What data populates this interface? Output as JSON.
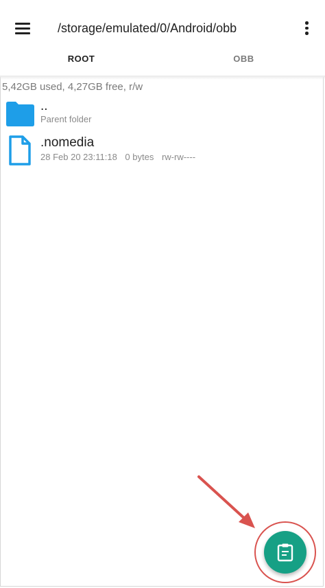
{
  "appbar": {
    "menu_icon": "hamburger-menu-icon",
    "path": "/storage/emulated/0/Android/obb",
    "overflow_icon": "more-vert-icon"
  },
  "tabs": [
    {
      "label": "ROOT",
      "active": true
    },
    {
      "label": "OBB",
      "active": false
    }
  ],
  "storage_info": "5,42GB used, 4,27GB free, r/w",
  "files": [
    {
      "icon": "folder-icon",
      "name": "..",
      "subtitle": "Parent folder"
    },
    {
      "icon": "file-icon",
      "name": ".nomedia",
      "date": "28 Feb 20 23:11:18",
      "size": "0 bytes",
      "permissions": "rw-rw----"
    }
  ],
  "fab": {
    "icon": "clipboard-paste-icon",
    "color": "#16a085"
  },
  "colors": {
    "folder": "#1e9ee8",
    "accent": "#16a085",
    "annotation": "#d9534f"
  }
}
